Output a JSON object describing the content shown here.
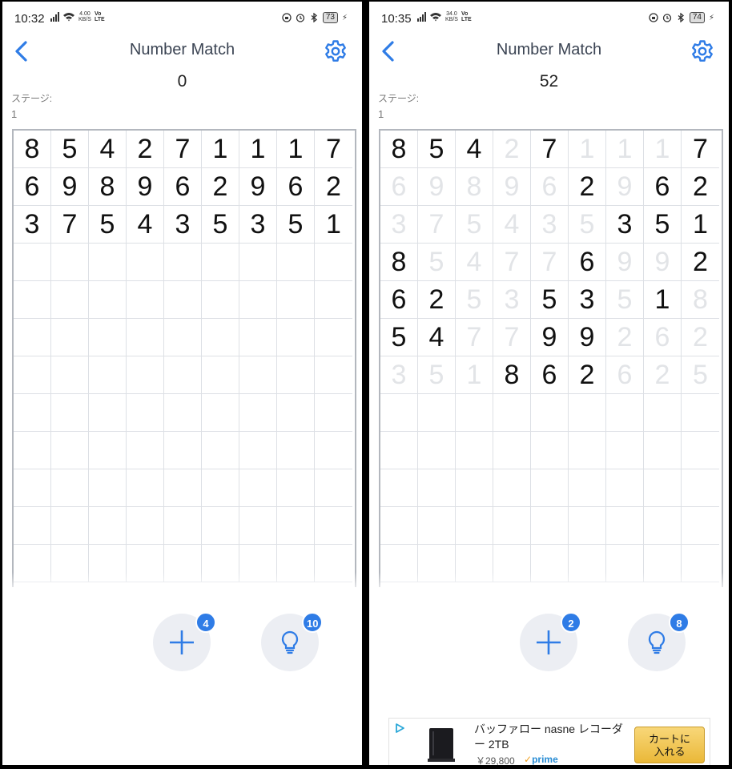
{
  "screens": [
    {
      "status": {
        "time": "10:32",
        "net_speed": "4.00\nKB/S",
        "volte": "Vo\nLTE",
        "battery": "73"
      },
      "title": "Number Match",
      "score": "0",
      "stage_label": "ステージ:",
      "stage_value": "1",
      "grid": {
        "values": [
          [
            8,
            5,
            4,
            2,
            7,
            1,
            1,
            1,
            7
          ],
          [
            6,
            9,
            8,
            9,
            6,
            2,
            9,
            6,
            2
          ],
          [
            3,
            7,
            5,
            4,
            3,
            5,
            3,
            5,
            1
          ]
        ],
        "cleared": [
          [
            0,
            0,
            0,
            0,
            0,
            0,
            0,
            0,
            0
          ],
          [
            0,
            0,
            0,
            0,
            0,
            0,
            0,
            0,
            0
          ],
          [
            0,
            0,
            0,
            0,
            0,
            0,
            0,
            0,
            0
          ]
        ]
      },
      "add_count": "4",
      "hint_count": "10",
      "icons": {
        "back": "chevron-left-icon",
        "settings": "gear-icon",
        "add": "plus-icon",
        "hint": "lightbulb-icon"
      },
      "accent": "#2f7ce6"
    },
    {
      "status": {
        "time": "10:35",
        "net_speed": "34.0\nKB/S",
        "volte": "Vo\nLTE",
        "battery": "74"
      },
      "title": "Number Match",
      "score": "52",
      "stage_label": "ステージ:",
      "stage_value": "1",
      "grid": {
        "values": [
          [
            8,
            5,
            4,
            2,
            7,
            1,
            1,
            1,
            7
          ],
          [
            6,
            9,
            8,
            9,
            6,
            2,
            9,
            6,
            2
          ],
          [
            3,
            7,
            5,
            4,
            3,
            5,
            3,
            5,
            1
          ],
          [
            8,
            5,
            4,
            7,
            7,
            6,
            9,
            9,
            2
          ],
          [
            6,
            2,
            5,
            3,
            5,
            3,
            5,
            1,
            8
          ],
          [
            5,
            4,
            7,
            7,
            9,
            9,
            2,
            6,
            2
          ],
          [
            3,
            5,
            1,
            8,
            6,
            2,
            6,
            2,
            5
          ]
        ],
        "cleared": [
          [
            0,
            0,
            0,
            1,
            0,
            1,
            1,
            1,
            0
          ],
          [
            1,
            1,
            1,
            1,
            1,
            0,
            1,
            0,
            0
          ],
          [
            1,
            1,
            1,
            1,
            1,
            1,
            0,
            0,
            0
          ],
          [
            0,
            1,
            1,
            1,
            1,
            0,
            1,
            1,
            0
          ],
          [
            0,
            0,
            1,
            1,
            0,
            0,
            1,
            0,
            1
          ],
          [
            0,
            0,
            1,
            1,
            0,
            0,
            1,
            1,
            1
          ],
          [
            1,
            1,
            1,
            0,
            0,
            0,
            1,
            1,
            1
          ]
        ]
      },
      "add_count": "2",
      "hint_count": "8",
      "icons": {
        "back": "chevron-left-icon",
        "settings": "gear-icon",
        "add": "plus-icon",
        "hint": "lightbulb-icon"
      },
      "accent": "#2f7ce6",
      "ad": {
        "text": "バッファロー nasne レコーダー 2TB",
        "price": "￥29,800",
        "prime": "prime",
        "button": "カートに\n入れる"
      }
    }
  ]
}
